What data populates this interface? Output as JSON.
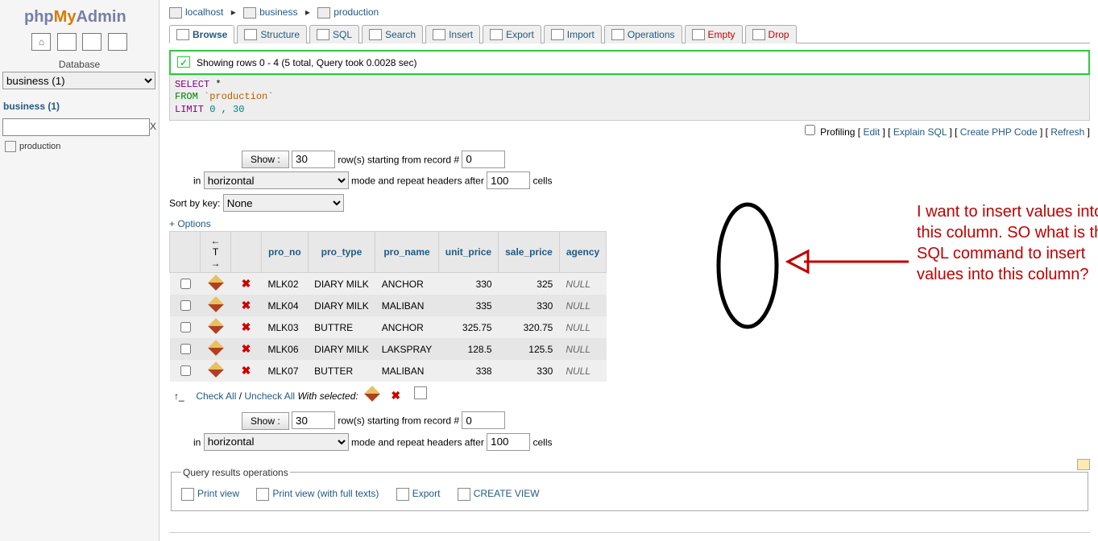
{
  "logo": {
    "p1": "php",
    "p2": "My",
    "p3": "Admin"
  },
  "sidebar": {
    "database_label": "Database",
    "database_selected": "business (1)",
    "db_link": "business (1)",
    "filter_x": "X",
    "table_name": "production"
  },
  "breadcrumb": {
    "server": "localhost",
    "database": "business",
    "table": "production"
  },
  "tabs": [
    {
      "label": "Browse",
      "danger": false,
      "active": true
    },
    {
      "label": "Structure",
      "danger": false,
      "active": false
    },
    {
      "label": "SQL",
      "danger": false,
      "active": false
    },
    {
      "label": "Search",
      "danger": false,
      "active": false
    },
    {
      "label": "Insert",
      "danger": false,
      "active": false
    },
    {
      "label": "Export",
      "danger": false,
      "active": false
    },
    {
      "label": "Import",
      "danger": false,
      "active": false
    },
    {
      "label": "Operations",
      "danger": false,
      "active": false
    },
    {
      "label": "Empty",
      "danger": true,
      "active": false
    },
    {
      "label": "Drop",
      "danger": true,
      "active": false
    }
  ],
  "status": {
    "message": "Showing rows 0 - 4 (5 total, Query took 0.0028 sec)"
  },
  "sql": {
    "select": "SELECT",
    "star": "*",
    "from": "FROM",
    "table": "`production`",
    "limit": "LIMIT",
    "range": "0 , 30"
  },
  "query_links": {
    "profiling": "Profiling",
    "edit": "Edit",
    "explain": "Explain SQL",
    "php": "Create PHP Code",
    "refresh": "Refresh"
  },
  "controls": {
    "show_btn": "Show :",
    "rows": "30",
    "rows_label": "row(s) starting from record #",
    "start": "0",
    "in": "in",
    "mode": "horizontal",
    "mode_label": "mode and repeat headers after",
    "repeat": "100",
    "cells": "cells",
    "sort_label": "Sort by key:",
    "sort_value": "None",
    "options": "+ Options"
  },
  "table": {
    "headers": [
      "pro_no",
      "pro_type",
      "pro_name",
      "unit_price",
      "sale_price",
      "agency"
    ],
    "rows": [
      {
        "pro_no": "MLK02",
        "pro_type": "DIARY MILK",
        "pro_name": "ANCHOR",
        "unit_price": "330",
        "sale_price": "325",
        "agency": "NULL"
      },
      {
        "pro_no": "MLK04",
        "pro_type": "DIARY MILK",
        "pro_name": "MALIBAN",
        "unit_price": "335",
        "sale_price": "330",
        "agency": "NULL"
      },
      {
        "pro_no": "MLK03",
        "pro_type": "BUTTRE",
        "pro_name": "ANCHOR",
        "unit_price": "325.75",
        "sale_price": "320.75",
        "agency": "NULL"
      },
      {
        "pro_no": "MLK06",
        "pro_type": "DIARY MILK",
        "pro_name": "LAKSPRAY",
        "unit_price": "128.5",
        "sale_price": "125.5",
        "agency": "NULL"
      },
      {
        "pro_no": "MLK07",
        "pro_type": "BUTTER",
        "pro_name": "MALIBAN",
        "unit_price": "338",
        "sale_price": "330",
        "agency": "NULL"
      }
    ]
  },
  "row_actions": {
    "check_all": "Check All",
    "uncheck_all": "Uncheck All",
    "with_selected": "With selected:",
    "slash": " / "
  },
  "fieldset": {
    "legend": "Query results operations",
    "print": "Print view",
    "print_full": "Print view (with full texts)",
    "export": "Export",
    "create_view": "CREATE VIEW"
  },
  "annotation": {
    "text": "I want to insert values into this column. SO what is the SQL command to insert values into this column?"
  }
}
